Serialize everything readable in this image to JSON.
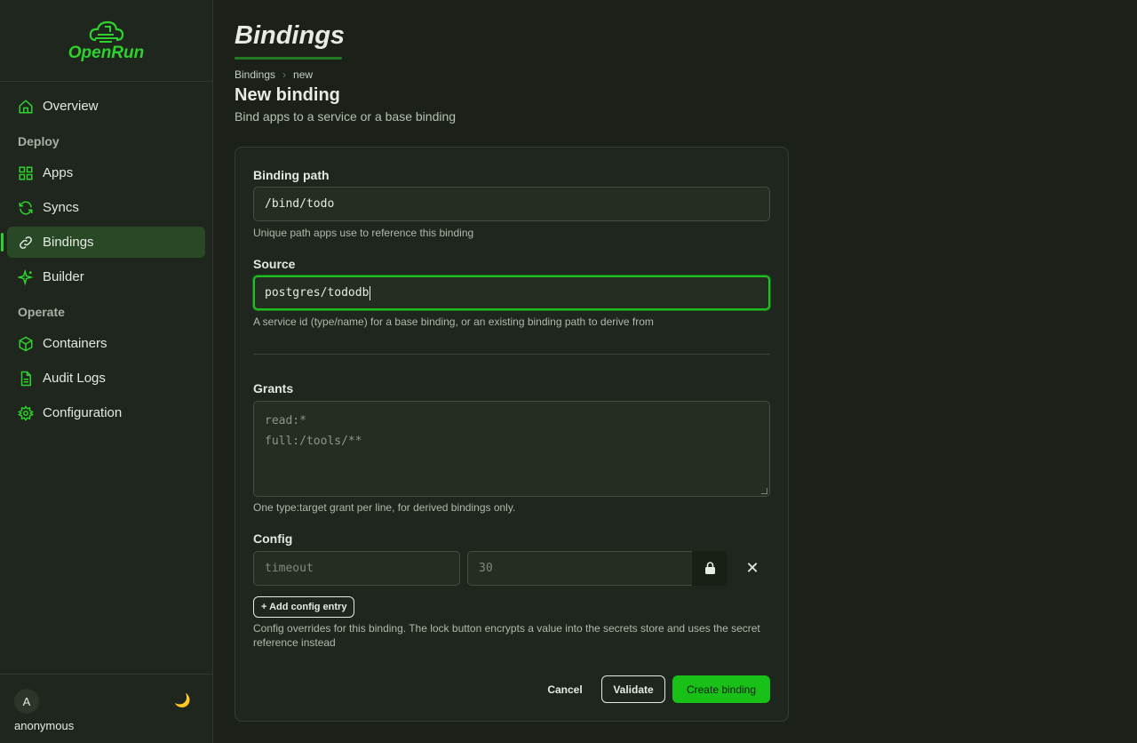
{
  "app": {
    "name": "OpenRun"
  },
  "sidebar": {
    "items": [
      {
        "label": "Overview",
        "icon": "home-icon"
      },
      {
        "section": "Deploy"
      },
      {
        "label": "Apps",
        "icon": "grid-icon"
      },
      {
        "label": "Syncs",
        "icon": "refresh-icon"
      },
      {
        "label": "Bindings",
        "icon": "link-icon",
        "active": true
      },
      {
        "label": "Builder",
        "icon": "sparkle-icon"
      },
      {
        "section": "Operate"
      },
      {
        "label": "Containers",
        "icon": "cube-icon"
      },
      {
        "label": "Audit Logs",
        "icon": "document-icon"
      },
      {
        "label": "Configuration",
        "icon": "gear-icon"
      }
    ],
    "user": {
      "initial": "A",
      "name": "anonymous"
    },
    "theme_icon": "🌙"
  },
  "header": {
    "title": "Bindings",
    "breadcrumb": [
      "Bindings",
      "new"
    ],
    "breadcrumb_sep": "›"
  },
  "form": {
    "heading": "New binding",
    "subheading": "Bind apps to a service or a base binding",
    "binding_path": {
      "label": "Binding path",
      "value": "/bind/todo",
      "help": "Unique path apps use to reference this binding"
    },
    "source": {
      "label": "Source",
      "value": "postgres/tododb",
      "help": "A service id (type/name) for a base binding, or an existing binding path to derive from"
    },
    "grants": {
      "label": "Grants",
      "placeholder_lines": [
        "read:*",
        "full:/tools/**"
      ],
      "help": "One type:target grant per line, for derived bindings only."
    },
    "config": {
      "label": "Config",
      "key_placeholder": "timeout",
      "value_placeholder": "30",
      "add_label": "+ Add config entry",
      "remove_label": "✕",
      "help": "Config overrides for this binding. The lock button encrypts a value into the secrets store and uses the secret reference instead"
    },
    "actions": {
      "cancel": "Cancel",
      "validate": "Validate",
      "create": "Create binding"
    }
  },
  "colors": {
    "accent": "#2fd12f",
    "background": "#1b2119",
    "card": "#1f261d",
    "primary_button": "#18c018"
  }
}
